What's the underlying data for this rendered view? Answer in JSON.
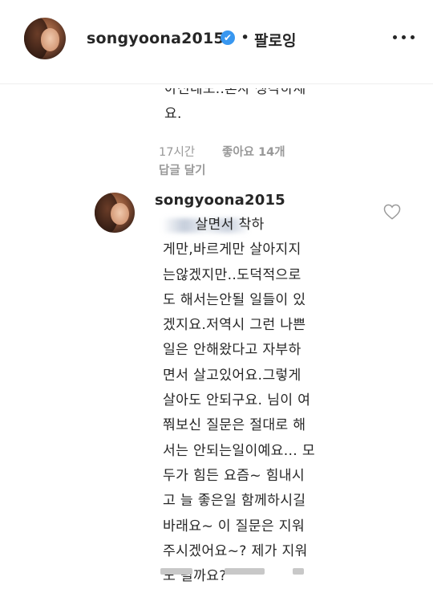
{
  "header": {
    "username": "songyoona2015",
    "separator": "•",
    "follow_status": "팔로잉",
    "verified_mark": "✔",
    "more_icon": "more-horizontal-icon"
  },
  "previous_comment": {
    "cut_line": "아신네도..혼자 생각하세",
    "continued_line": "요.",
    "time": "17시간",
    "likes": "좋아요 14개",
    "reply_action": "답글 달기"
  },
  "reply": {
    "username": "songyoona2015",
    "body": "       살면서 착하\n게만,바르게만 살아지지\n는않겠지만..도덕적으로\n도 해서는안될 일들이 있\n겠지요.저역시 그런 나쁜\n일은 안해왔다고 자부하\n면서 살고있어요.그렇게\n살아도 안되구요. 님이 여\n쭤보신 질문은 절대로 해\n서는 안되는일이예요... 모\n두가 힘든 요즘~ 힘내시\n고 늘 좋은일 함께하시길\n바래요~ 이 질문은 지워\n주시겠어요~? 제가 지워\n도 될까요?",
    "like_icon": "heart-icon"
  },
  "colors": {
    "text": "#262626",
    "meta": "#999999",
    "verified": "#3897f0",
    "divider": "#efefef"
  }
}
